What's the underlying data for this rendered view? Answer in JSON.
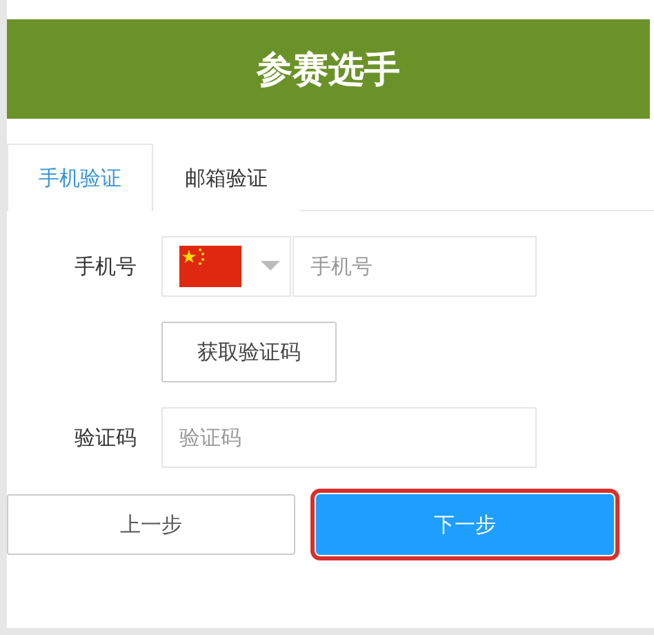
{
  "header": {
    "title": "参赛选手"
  },
  "tabs": [
    {
      "label": "手机验证",
      "selected": true
    },
    {
      "label": "邮箱验证",
      "selected": false
    }
  ],
  "form": {
    "phone_label": "手机号",
    "phone_placeholder": "手机号",
    "get_code_button": "获取验证码",
    "code_label": "验证码",
    "code_placeholder": "验证码"
  },
  "buttons": [
    {
      "label": "上一步",
      "kind": "secondary",
      "highlighted": false
    },
    {
      "label": "下一步",
      "kind": "primary",
      "highlighted": true
    }
  ]
}
